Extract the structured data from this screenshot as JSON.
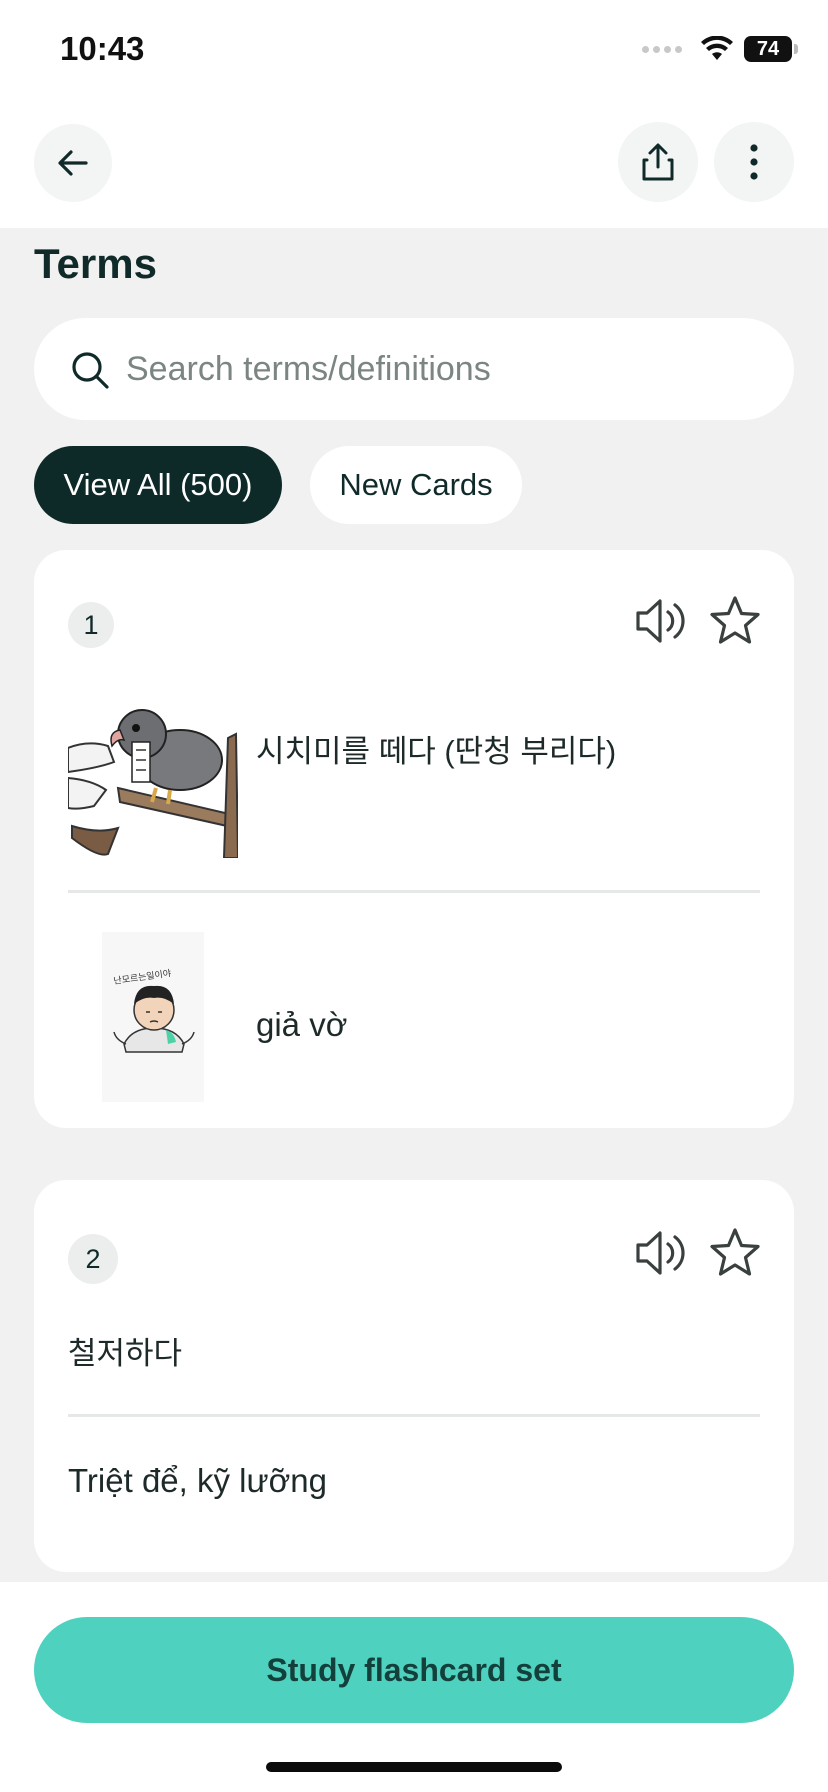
{
  "status_bar": {
    "time": "10:43",
    "battery": "74"
  },
  "top_bar": {
    "back_icon": "arrow-left-icon",
    "share_icon": "share-icon",
    "more_icon": "more-vertical-icon"
  },
  "section": {
    "title": "Terms"
  },
  "search": {
    "placeholder": "Search terms/definitions",
    "value": ""
  },
  "filters": [
    {
      "label": "View All (500)",
      "active": true
    },
    {
      "label": "New Cards",
      "active": false
    }
  ],
  "cards": [
    {
      "number": "1",
      "term": "시치미를 떼다 (딴청 부리다)",
      "term_image": "cartoon-hawk-on-arm",
      "definition": "giả vờ",
      "definition_image": "cartoon-shrugging-man"
    },
    {
      "number": "2",
      "term": "철저하다",
      "definition": "Triệt để, kỹ lưỡng"
    }
  ],
  "actions": {
    "study_label": "Study flashcard set"
  },
  "colors": {
    "accent": "#4fd1c0",
    "dark": "#0d2a28",
    "background": "#f1f1f1"
  }
}
